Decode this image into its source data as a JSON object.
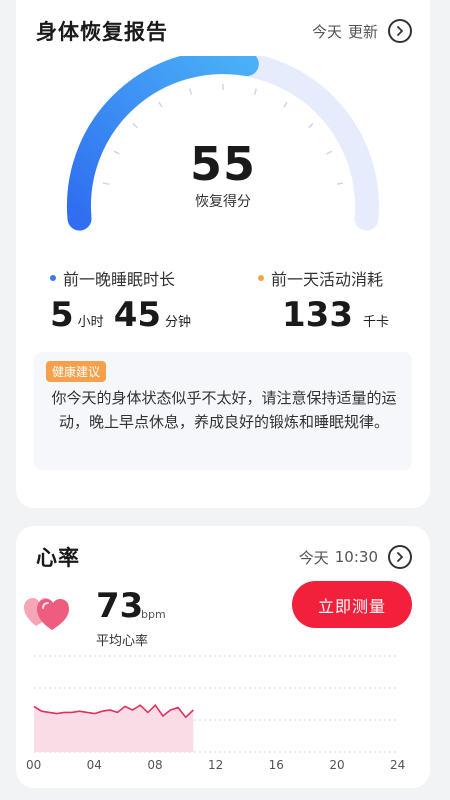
{
  "recovery": {
    "title": "身体恢复报告",
    "meta_day": "今天",
    "meta_action": "更新",
    "score": "55",
    "score_label": "恢复得分",
    "score_fraction": 0.55,
    "sleep": {
      "label": "前一晚睡眠时长",
      "hours": "5",
      "hours_unit": "小时",
      "minutes": "45",
      "minutes_unit": "分钟",
      "dot_color": "#3a7bf0"
    },
    "activity": {
      "label": "前一天活动消耗",
      "value": "133",
      "unit": "千卡",
      "dot_color": "#f5a04a"
    },
    "advice": {
      "tag": "健康建议",
      "text": "你今天的身体状态似乎不太好，请注意保持适量的运动，晚上早点休息，养成良好的锻炼和睡眠规律。"
    }
  },
  "heart": {
    "title": "心率",
    "meta_day": "今天",
    "meta_time": "10:30",
    "value": "73",
    "unit": "bpm",
    "label": "平均心率",
    "button": "立即测量",
    "x_ticks": [
      "00",
      "04",
      "08",
      "12",
      "16",
      "20",
      "24"
    ]
  },
  "chart_data": {
    "type": "line",
    "x": [
      0,
      0.5,
      1,
      1.5,
      2,
      2.5,
      3,
      3.5,
      4,
      4.5,
      5,
      5.5,
      6,
      6.5,
      7,
      7.5,
      8,
      8.5,
      9,
      9.5,
      10,
      10.5
    ],
    "values": [
      78,
      74,
      73,
      72,
      73,
      73,
      74,
      73,
      72,
      74,
      75,
      73,
      78,
      75,
      79,
      73,
      79,
      70,
      75,
      77,
      69,
      75
    ],
    "xlim": [
      0,
      24
    ],
    "ylim": [
      40,
      120
    ],
    "x_ticks": [
      "00",
      "04",
      "08",
      "12",
      "16",
      "20",
      "24"
    ],
    "line_color": "#e0305e",
    "fill_color": "#f9dce6",
    "grid": true
  }
}
